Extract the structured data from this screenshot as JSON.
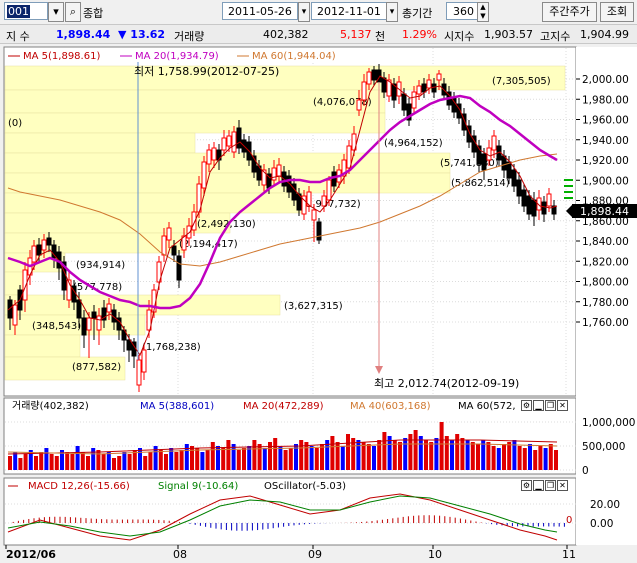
{
  "toolbar": {
    "code": "001",
    "name": "종합",
    "start_date": "2011-05-26",
    "end_date": "2012-11-01",
    "period_label": "총기간",
    "period_value": "360",
    "weekly_button": "주간주가",
    "query_button": "조회"
  },
  "quote": {
    "index_label": "지 수",
    "price": "1,898.44",
    "change": "▼ 13.62",
    "volume_label": "거래량",
    "volume": "402,382",
    "amount": "5,137",
    "amount_unit": "천",
    "rate": "1.29%",
    "open_label": "시지수",
    "open": "1,903.57",
    "high_label": "고지수",
    "high": "1,904.99"
  },
  "colors": {
    "up": "#ff0000",
    "down": "#0000ff",
    "ma5": "#c00000",
    "ma20": "#c000c0",
    "ma60": "#d07830",
    "signal": "#008000"
  },
  "price_panel": {
    "legend": {
      "ma5": "MA 5(1,898.61)",
      "ma20": "MA 20(1,934.79)",
      "ma60": "MA 60(1,944.04)"
    },
    "low_note": "최저 1,758.99(2012-07-25)",
    "high_note": "최고 2,012.74(2012-09-19)",
    "current_price": "1,898.44",
    "profile_labels": [
      "(7,305,505)",
      "(4,076,078)",
      "(4,964,152)",
      "(5,741,830)",
      "(5,862,514)",
      "(3,907,732)",
      "(2,492,130)",
      "(2,194,417)",
      "(934,914)",
      "(577,778)",
      "(348,543)",
      "(3,627,315)",
      "(1,768,238)",
      "(877,582)",
      "(0)"
    ],
    "y_ticks": [
      "2,000.00",
      "1,980.00",
      "1,960.00",
      "1,940.00",
      "1,920.00",
      "1,900.00",
      "1,880.00",
      "1,860.00",
      "1,840.00",
      "1,820.00",
      "1,800.00",
      "1,780.00",
      "1,760.00"
    ]
  },
  "volume_panel": {
    "legend": {
      "vol": "거래량(402,382)",
      "ma5": "MA 5(388,601)",
      "ma20": "MA 20(472,289)",
      "ma40": "MA 40(603,168)",
      "ma60": "MA 60(572,"
    },
    "y_ticks": [
      "1,000,000",
      "500,000",
      "0"
    ]
  },
  "macd_panel": {
    "legend": {
      "macd": "MACD 12,26(-15.66)",
      "signal": "Signal 9(-10.64)",
      "osc": "OScillator(-5.03)"
    },
    "y_ticks": [
      "20.00",
      "0.00"
    ],
    "zero_label": "0"
  },
  "x_axis": [
    "2012/06",
    "08",
    "09",
    "10",
    "11"
  ]
}
